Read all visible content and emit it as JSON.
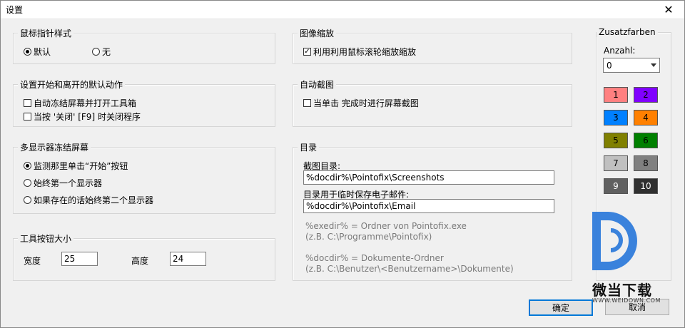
{
  "window": {
    "title": "设置",
    "close_glyph": "✕"
  },
  "pointer_style": {
    "legend": "鼠标指针样式",
    "options": [
      {
        "label": "默认",
        "selected": true
      },
      {
        "label": "无",
        "selected": false
      }
    ]
  },
  "start_exit": {
    "legend": "设置开始和离开的默认动作",
    "options": [
      {
        "label": "自动冻结屏幕并打开工具箱",
        "checked": false
      },
      {
        "label": "当按 '关闭' [F9] 时关闭程序",
        "checked": false
      }
    ]
  },
  "multi_monitor": {
    "legend": "多显示器冻结屏幕",
    "options": [
      {
        "label": "监测那里单击“开始”按钮",
        "selected": true
      },
      {
        "label": "始终第一个显示器",
        "selected": false
      },
      {
        "label": "如果存在的话始终第二个显示器",
        "selected": false
      }
    ]
  },
  "toolbar_size": {
    "legend": "工具按钮大小",
    "width_label": "宽度",
    "width_value": "25",
    "height_label": "高度",
    "height_value": "24"
  },
  "image_zoom": {
    "legend": "图像缩放",
    "option": {
      "label": "利用利用鼠标滚轮缩放缩放",
      "checked": true
    }
  },
  "auto_capture": {
    "legend": "自动截图",
    "option": {
      "label": "当单击 完成时进行屏幕截图",
      "checked": false
    }
  },
  "directory": {
    "legend": "目录",
    "screenshot_label": "截图目录:",
    "screenshot_value": "%docdir%\\Pointofix\\Screenshots",
    "email_label": "目录用于临时保存电子邮件:",
    "email_value": "%docdir%\\Pointofix\\Email",
    "hints": [
      "%exedir% = Ordner von Pointofix.exe",
      "(z.B. C:\\Programme\\Pointofix)",
      "%docdir% = Dokumente-Ordner",
      "(z.B. C:\\Benutzer\\<Benutzername>\\Dokumente)"
    ]
  },
  "extra_colors": {
    "legend": "Zusatzfarben",
    "count_label": "Anzahl:",
    "count_value": "0",
    "swatches": [
      {
        "label": "1",
        "color": "#ff8080"
      },
      {
        "label": "2",
        "color": "#8000ff"
      },
      {
        "label": "3",
        "color": "#0080ff"
      },
      {
        "label": "4",
        "color": "#ff8000"
      },
      {
        "label": "5",
        "color": "#808000"
      },
      {
        "label": "6",
        "color": "#008000"
      },
      {
        "label": "7",
        "color": "#c0c0c0"
      },
      {
        "label": "8",
        "color": "#808080"
      },
      {
        "label": "9",
        "color": "#606060"
      },
      {
        "label": "10",
        "color": "#303030"
      }
    ]
  },
  "buttons": {
    "ok": "确定",
    "cancel": "取消"
  },
  "watermark": {
    "brand": "微当下载",
    "url": "WWW.WEIDOWN.COM",
    "color": "#1a6fd8"
  }
}
